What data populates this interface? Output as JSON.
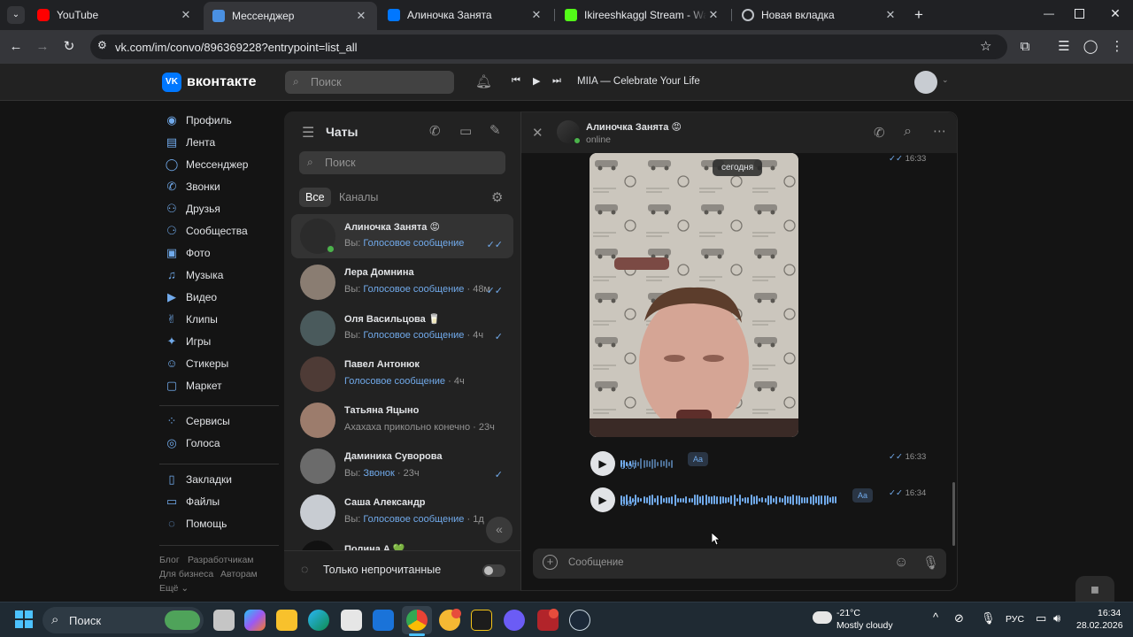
{
  "browser": {
    "tabs": [
      {
        "title": "YouTube",
        "icon": "youtube-icon",
        "color": "#ff0000"
      },
      {
        "title": "Мессенджер",
        "icon": "vk-messenger-icon",
        "color": "#4a90e2",
        "active": true
      },
      {
        "title": "Алиночка Занята",
        "icon": "vk-icon",
        "color": "#0077ff"
      },
      {
        "title": "Ikireeshkaggl Stream - Watch Li",
        "icon": "kick-icon",
        "color": "#53fc18"
      },
      {
        "title": "Новая вкладка",
        "icon": "chrome-icon",
        "color": "#bdc1c6"
      }
    ],
    "url": "vk.com/im/convo/896369228?entrypoint=list_all"
  },
  "vk": {
    "logo_text": "вконтакте",
    "search_placeholder": "Поиск",
    "player_track": "MIIA — Celebrate Your Life",
    "nav": [
      {
        "label": "Профиль",
        "icon": "profile-icon"
      },
      {
        "label": "Лента",
        "icon": "feed-icon"
      },
      {
        "label": "Мессенджер",
        "icon": "messenger-icon"
      },
      {
        "label": "Звонки",
        "icon": "phone-icon"
      },
      {
        "label": "Друзья",
        "icon": "friends-icon"
      },
      {
        "label": "Сообщества",
        "icon": "communities-icon"
      },
      {
        "label": "Фото",
        "icon": "photo-icon"
      },
      {
        "label": "Музыка",
        "icon": "music-icon"
      },
      {
        "label": "Видео",
        "icon": "video-icon"
      },
      {
        "label": "Клипы",
        "icon": "clips-icon"
      },
      {
        "label": "Игры",
        "icon": "games-icon"
      },
      {
        "label": "Стикеры",
        "icon": "stickers-icon"
      },
      {
        "label": "Маркет",
        "icon": "market-icon"
      },
      {
        "label": "Сервисы",
        "icon": "services-icon"
      },
      {
        "label": "Голоса",
        "icon": "votes-icon"
      },
      {
        "label": "Закладки",
        "icon": "bookmarks-icon"
      },
      {
        "label": "Файлы",
        "icon": "files-icon"
      },
      {
        "label": "Помощь",
        "icon": "help-icon"
      }
    ],
    "footer": {
      "blog": "Блог",
      "devs": "Разработчикам",
      "business": "Для бизнеса",
      "authors": "Авторам",
      "more": "Ещё"
    }
  },
  "chats": {
    "title": "Чаты",
    "search_placeholder": "Поиск",
    "tab_all": "Все",
    "tab_channels": "Каналы",
    "unread_only": "Только непрочитанные",
    "items": [
      {
        "name": "Алиночка Занята 😡",
        "prefix": "Вы: ",
        "text": "Голосовое сообщение",
        "time": "",
        "tick": "✓✓",
        "avatar": "#2b2b2b"
      },
      {
        "name": "Лера Домнина",
        "prefix": "Вы: ",
        "text": "Голосовое сообщение",
        "time": " · 48м",
        "tick": "✓✓",
        "avatar": "#8a7d72"
      },
      {
        "name": "Оля Васильцова 🥛",
        "prefix": "Вы: ",
        "text": "Голосовое сообщение",
        "time": " · 4ч",
        "tick": "✓",
        "avatar": "#4a5a5c"
      },
      {
        "name": "Павел Антонюк",
        "prefix": "",
        "text": "Голосовое сообщение",
        "time": " · 4ч",
        "tick": "",
        "avatar": "#4e3b36"
      },
      {
        "name": "Татьяна Яцыно",
        "prefix": "",
        "text": "Ахахаха прикольно конечно",
        "time": " · 23ч",
        "tick": "",
        "avatar": "#9c7c6c",
        "plain": true
      },
      {
        "name": "Даминика Суворова",
        "prefix": "Вы: ",
        "text": "Звонок",
        "time": " · 23ч",
        "tick": "✓",
        "avatar": "#6b6b6b"
      },
      {
        "name": "Саша Александр",
        "prefix": "Вы: ",
        "text": "Голосовое сообщение",
        "time": " · 1д",
        "tick": "",
        "avatar": "#c8ccd2"
      },
      {
        "name": "Полина А 💚",
        "prefix": "",
        "text": "",
        "time": "",
        "tick": "",
        "avatar": "#111111"
      }
    ]
  },
  "conversation": {
    "name": "Алиночка Занята 😡",
    "status": "online",
    "date_badge": "сегодня",
    "messages": [
      {
        "type": "video",
        "time": "16:33"
      },
      {
        "type": "voice",
        "duration": "0:07",
        "time": "16:33",
        "aa": "Aa",
        "progress": 0.2
      },
      {
        "type": "voice",
        "duration": "0:07",
        "time": "16:34",
        "aa": "Aa",
        "progress": 1.0
      }
    ],
    "input_placeholder": "Сообщение"
  },
  "taskbar": {
    "search_label": "Поиск",
    "weather_temp": "-21°C",
    "weather_text": "Mostly cloudy",
    "lang": "РУС",
    "time": "16:34",
    "date": "28.02.2026"
  }
}
